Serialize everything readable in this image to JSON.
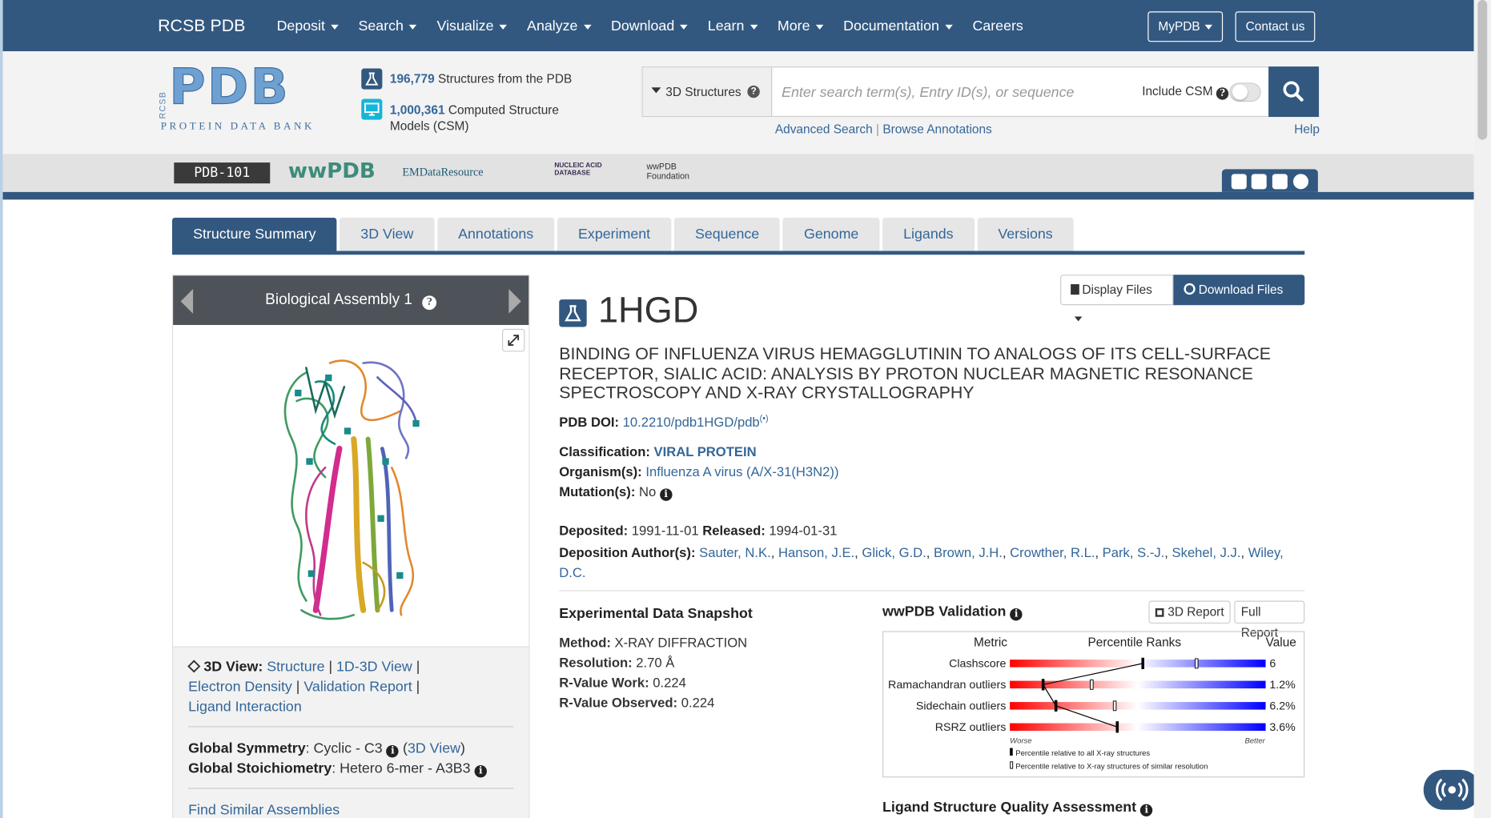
{
  "nav": {
    "brand": "RCSB PDB",
    "menu": [
      "Deposit",
      "Search",
      "Visualize",
      "Analyze",
      "Download",
      "Learn",
      "More",
      "Documentation",
      "Careers"
    ],
    "mypdb": "MyPDB",
    "contact": "Contact us"
  },
  "header": {
    "logo_main": "PDB",
    "logo_side": "RCSB",
    "logo_tagline": "PROTEIN DATA BANK",
    "structures_count": "196,779",
    "structures_label": "Structures from the PDB",
    "csm_count": "1,000,361",
    "csm_label_1": "Computed Structure",
    "csm_label_2": "Models (CSM)",
    "search_scope": "3D Structures",
    "search_placeholder": "Enter search term(s), Entry ID(s), or sequence",
    "include_csm": "Include CSM",
    "advanced_search": "Advanced Search",
    "browse_annotations": "Browse Annotations",
    "help": "Help"
  },
  "partners": [
    "PDB-101",
    "wwPDB",
    "EMDataResource",
    "NUCLEIC ACID DATABASE",
    "wwPDB Foundation"
  ],
  "tabs": [
    "Structure Summary",
    "3D View",
    "Annotations",
    "Experiment",
    "Sequence",
    "Genome",
    "Ligands",
    "Versions"
  ],
  "assembly": {
    "title": "Biological Assembly 1",
    "view_label": "3D View",
    "links": [
      "Structure",
      "1D-3D View",
      "Electron Density",
      "Validation Report",
      "Ligand Interaction"
    ],
    "symmetry_label": "Global Symmetry",
    "symmetry_value": "Cyclic - C3",
    "symmetry_link": "3D View",
    "stoich_label": "Global Stoichiometry",
    "stoich_value": "Hetero 6-mer - A3B3",
    "find_similar": "Find Similar Assemblies"
  },
  "entry": {
    "display_files": "Display Files",
    "download_files": "Download Files",
    "id": "1HGD",
    "title": "BINDING OF INFLUENZA VIRUS HEMAGGLUTININ TO ANALOGS OF ITS CELL-SURFACE RECEPTOR, SIALIC ACID: ANALYSIS BY PROTON NUCLEAR MAGNETIC RESONANCE SPECTROSCOPY AND X-RAY CRYSTALLOGRAPHY",
    "doi_label": "PDB DOI:",
    "doi": "10.2210/pdb1HGD/pdb",
    "classification_label": "Classification:",
    "classification": "VIRAL PROTEIN",
    "organism_label": "Organism(s):",
    "organism": "Influenza A virus (A/X-31(H3N2))",
    "mutation_label": "Mutation(s):",
    "mutation": "No",
    "deposited_label": "Deposited:",
    "deposited": "1991-11-01",
    "released_label": "Released:",
    "released": "1994-01-31",
    "authors_label": "Deposition Author(s):",
    "authors": [
      "Sauter, N.K.",
      "Hanson, J.E.",
      "Glick, G.D.",
      "Brown, J.H.",
      "Crowther, R.L.",
      "Park, S.-J.",
      "Skehel, J.J.",
      "Wiley, D.C."
    ]
  },
  "snapshot": {
    "heading": "Experimental Data Snapshot",
    "method_label": "Method:",
    "method": "X-RAY DIFFRACTION",
    "resolution_label": "Resolution:",
    "resolution": "2.70 Å",
    "rwork_label": "R-Value Work:",
    "rwork": "0.224",
    "robs_label": "R-Value Observed:",
    "robs": "0.224"
  },
  "validation": {
    "heading": "wwPDB Validation",
    "report_3d": "3D Report",
    "full_report": "Full Report",
    "col_metric": "Metric",
    "col_ranks": "Percentile Ranks",
    "col_value": "Value",
    "worse": "Worse",
    "better": "Better",
    "legend_all": "Percentile relative to all X-ray structures",
    "legend_similar": "Percentile relative to X-ray structures of similar resolution",
    "metrics": [
      {
        "name": "Clashscore",
        "value": "6",
        "pct_all": 0.52,
        "pct_similar": 0.73
      },
      {
        "name": "Ramachandran outliers",
        "value": "1.2%",
        "pct_all": 0.13,
        "pct_similar": 0.32
      },
      {
        "name": "Sidechain outliers",
        "value": "6.2%",
        "pct_all": 0.18,
        "pct_similar": 0.41
      },
      {
        "name": "RSRZ outliers",
        "value": "3.6%",
        "pct_all": 0.42,
        "pct_similar": null
      }
    ]
  },
  "ligand_heading": "Ligand Structure Quality Assessment",
  "colors": {
    "navy": "#325880",
    "link": "#336699"
  }
}
